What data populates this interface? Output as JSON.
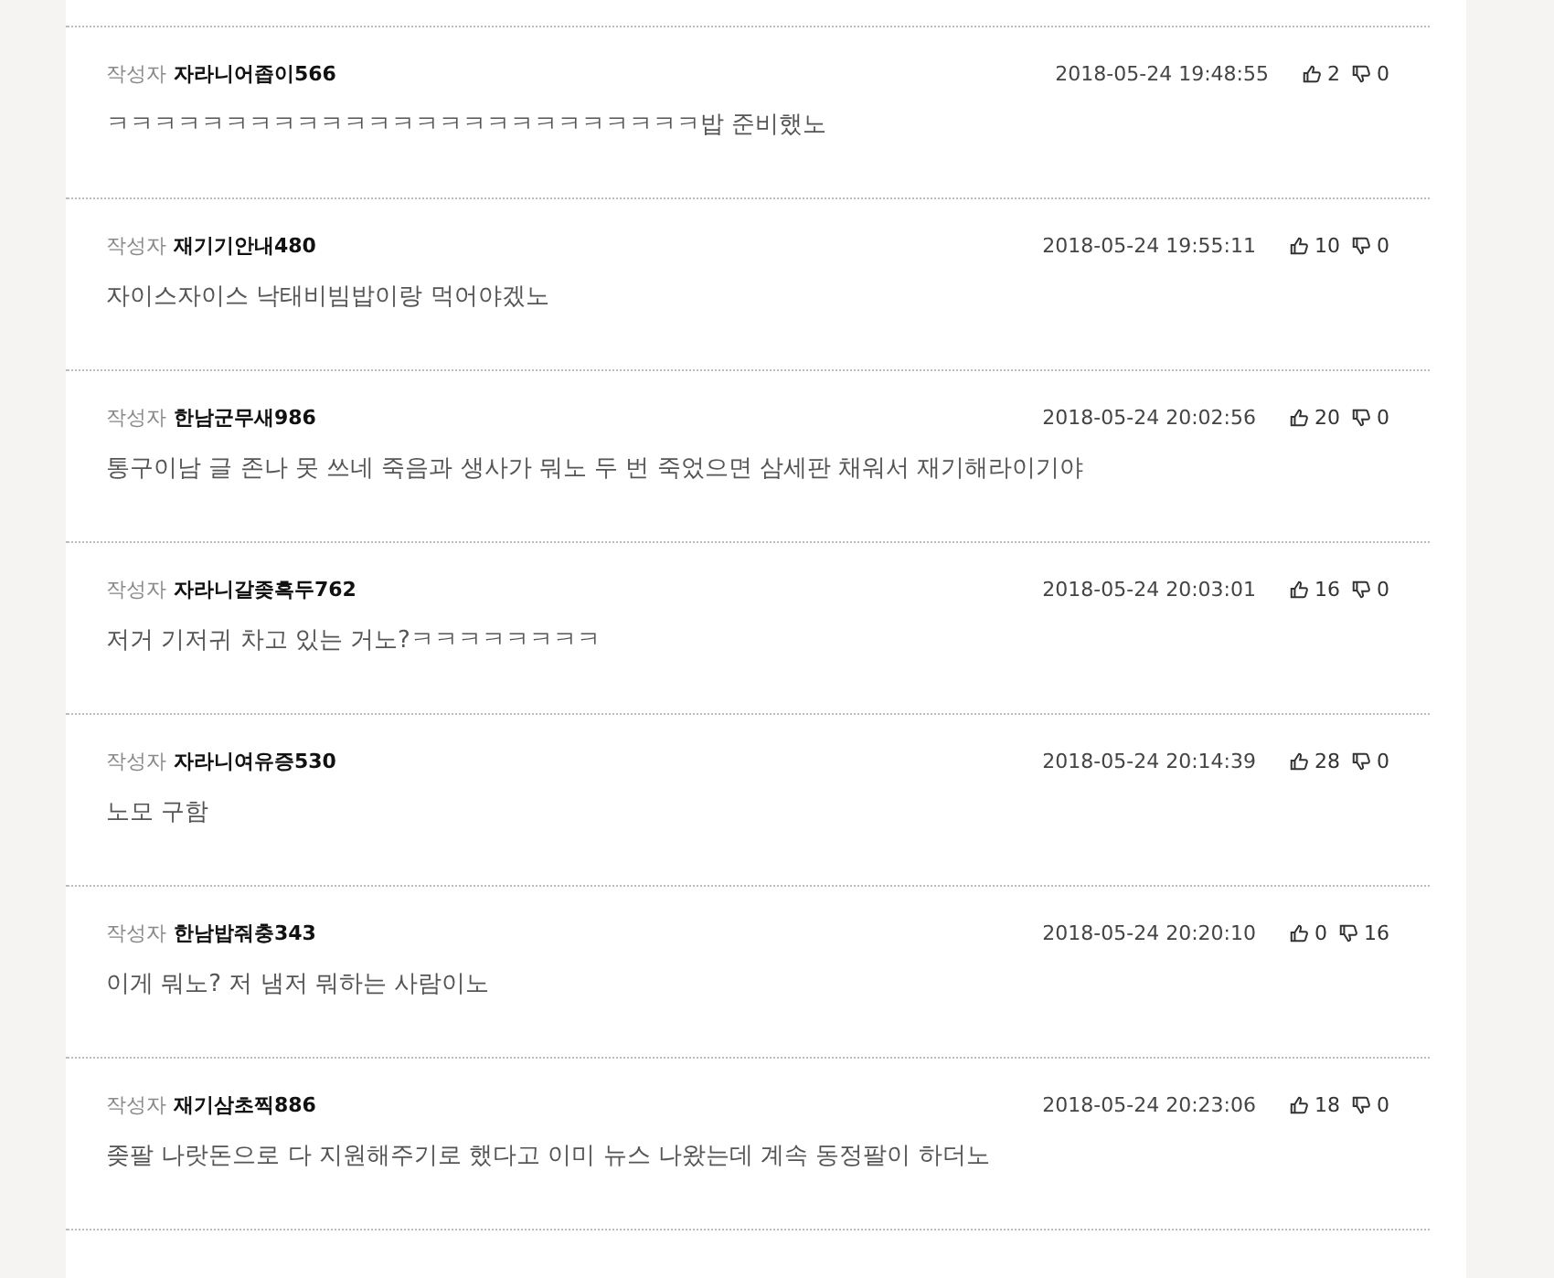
{
  "comments": [
    {
      "author_label": "작성자",
      "author": "자라니어좁이566",
      "time": "2018-05-24 19:48:55",
      "likes": "2",
      "dislikes": "0",
      "text": "ㅋㅋㅋㅋㅋㅋㅋㅋㅋㅋㅋㅋㅋㅋㅋㅋㅋㅋㅋㅋㅋㅋㅋㅋㅋ밥 준비했노"
    },
    {
      "author_label": "작성자",
      "author": "재기기안내480",
      "time": "2018-05-24 19:55:11",
      "likes": "10",
      "dislikes": "0",
      "text": "자이스자이스 낙태비빔밥이랑 먹어야겠노"
    },
    {
      "author_label": "작성자",
      "author": "한남군무새986",
      "time": "2018-05-24 20:02:56",
      "likes": "20",
      "dislikes": "0",
      "text": "통구이남 글 존나 못 쓰네 죽음과 생사가 뭐노 두 번 죽었으면 삼세판 채워서 재기해라이기야"
    },
    {
      "author_label": "작성자",
      "author": "자라니갈좆흑두762",
      "time": "2018-05-24 20:03:01",
      "likes": "16",
      "dislikes": "0",
      "text": "저거 기저귀 차고 있는 거노?ㅋㅋㅋㅋㅋㅋㅋㅋ"
    },
    {
      "author_label": "작성자",
      "author": "자라니여유증530",
      "time": "2018-05-24 20:14:39",
      "likes": "28",
      "dislikes": "0",
      "text": "노모 구함"
    },
    {
      "author_label": "작성자",
      "author": "한남밥줘충343",
      "time": "2018-05-24 20:20:10",
      "likes": "0",
      "dislikes": "16",
      "text": "이게 뭐노? 저 냄저 뭐하는 사람이노"
    },
    {
      "author_label": "작성자",
      "author": "재기삼초찍886",
      "time": "2018-05-24 20:23:06",
      "likes": "18",
      "dislikes": "0",
      "text": "좆팔 나랏돈으로 다 지원해주기로 했다고 이미 뉴스 나왔는데 계속 동정팔이 하더노"
    }
  ]
}
